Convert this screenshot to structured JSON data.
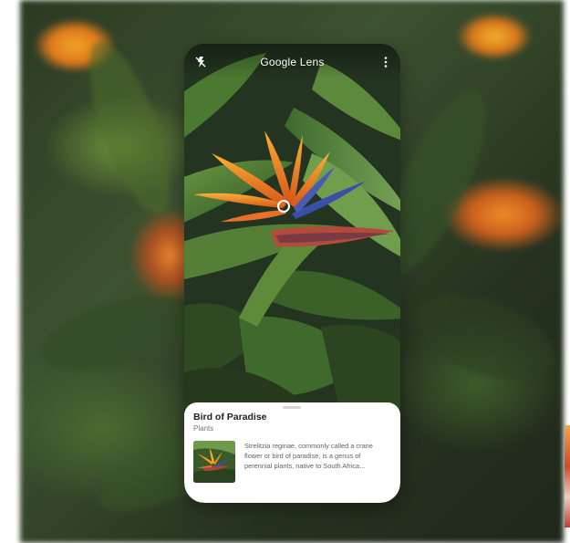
{
  "app": {
    "title": "Google Lens"
  },
  "icons": {
    "flash": "flash-off-icon",
    "menu": "more-vert-icon"
  },
  "result": {
    "title": "Bird of Paradise",
    "category": "Plants",
    "description": "Strelitzia reginae, commonly called a crane flower or bird of paradise, is a genus of perennial plants, native to South Africa..."
  },
  "colors": {
    "flower_orange": "#f28a1e",
    "flower_blue": "#3b4fa8",
    "leaf_green": "#3f6a2e",
    "card_background": "#ffffff"
  }
}
